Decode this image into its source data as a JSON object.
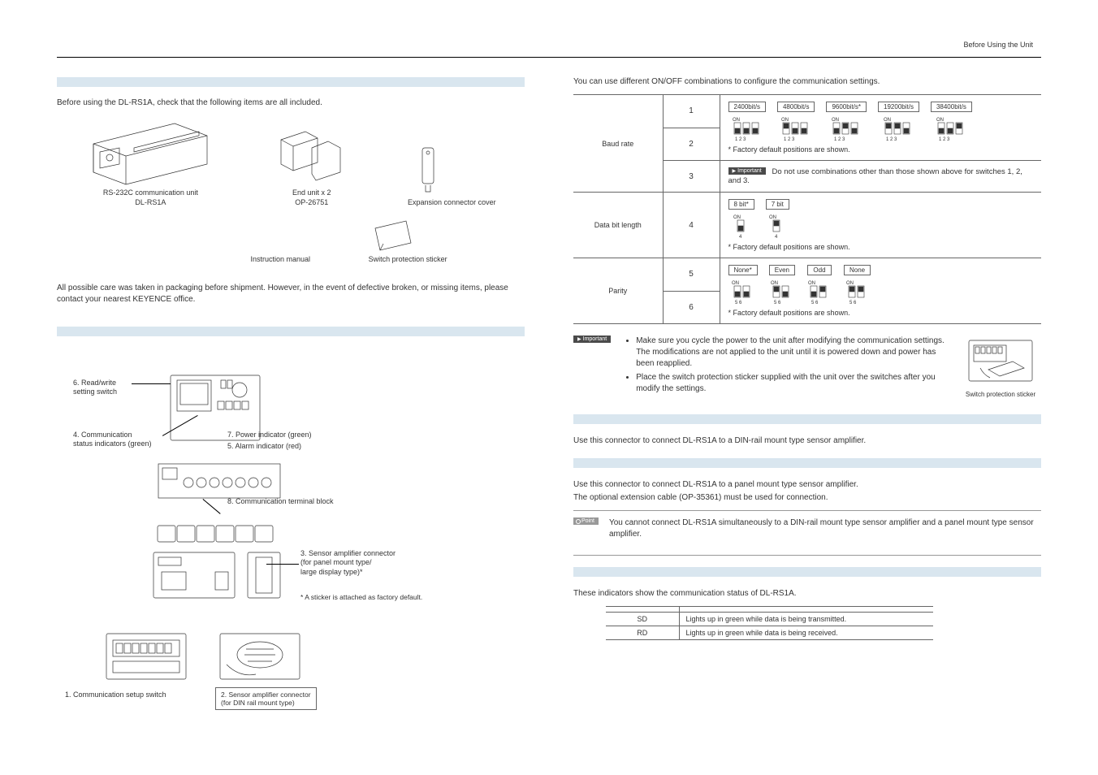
{
  "header": {
    "right": "Before Using the Unit"
  },
  "left": {
    "intro": "Before using the DL-RS1A, check that the following items are all included.",
    "captions": {
      "comm_unit_line1": "RS-232C communication unit",
      "comm_unit_line2": "DL-RS1A",
      "end_unit_line1": "End unit x 2",
      "end_unit_line2": "OP-26751",
      "exp_cover": "Expansion connector cover",
      "manual": "Instruction manual",
      "sticker": "Switch protection sticker"
    },
    "note": "All possible care was taken in packaging before shipment. However, in the event of defective broken, or missing items, please contact your nearest KEYENCE office.",
    "annotations": {
      "a6": "6. Read/write\nsetting switch",
      "a4": "4. Communication\nstatus indicators (green)",
      "a7": "7. Power indicator (green)",
      "a5": "5. Alarm indicator (red)",
      "a8": "8. Communication terminal block",
      "a3": "3. Sensor amplifier connector\n(for panel mount type/\nlarge display type)*",
      "a3foot": "* A sticker is attached as factory default.",
      "a1": "1. Communication setup switch",
      "a2": "2. Sensor amplifier connector\n(for DIN rail mount type)"
    }
  },
  "right": {
    "intro": "You can use different ON/OFF combinations to configure the communication settings.",
    "table": {
      "rows": [
        {
          "param": "Baud rate",
          "switches": [
            "1",
            "2",
            "3"
          ]
        },
        {
          "param": "Data bit length",
          "switches": [
            "4"
          ]
        },
        {
          "param": "Parity",
          "switches": [
            "5",
            "6"
          ]
        }
      ]
    },
    "baud_labels": [
      "2400bit/s",
      "4800bit/s",
      "9600bit/s*",
      "19200bit/s",
      "38400bit/s"
    ],
    "baud_nums": "1  2  3",
    "databit_labels": [
      "8 bit*",
      "7 bit"
    ],
    "parity_labels": [
      "None*",
      "Even",
      "Odd",
      "None"
    ],
    "on_label": "ON",
    "factory_note": "* Factory default positions are shown.",
    "important_badge": "Important",
    "baud_important": "Do not use combinations other than those shown above for switches 1, 2, and 3.",
    "info_bullets": [
      "Make sure you cycle the power to the unit after modifying the communication settings. The modifications are not applied to the unit until it is powered down and power has been reapplied.",
      "Place the switch protection sticker supplied with the unit over the switches after you modify the settings."
    ],
    "thumb_cap": "Switch protection sticker",
    "conn_din": "Use this connector to connect DL-RS1A to a DIN-rail mount type sensor amplifier.",
    "conn_panel_1": "Use this connector to connect DL-RS1A to a panel mount type sensor amplifier.",
    "conn_panel_2": "The optional extension cable (OP-35361) must be used for connection.",
    "point_badge": "Point",
    "point_text": "You cannot connect DL-RS1A simultaneously to a DIN-rail mount type sensor amplifier and a panel mount type sensor amplifier.",
    "ind_intro": "These indicators show the communication status of DL-RS1A.",
    "ind_table": {
      "rows": [
        {
          "name": "SD",
          "desc": "Lights up in green while data is being transmitted."
        },
        {
          "name": "RD",
          "desc": "Lights up in green while data is being received."
        }
      ]
    }
  }
}
